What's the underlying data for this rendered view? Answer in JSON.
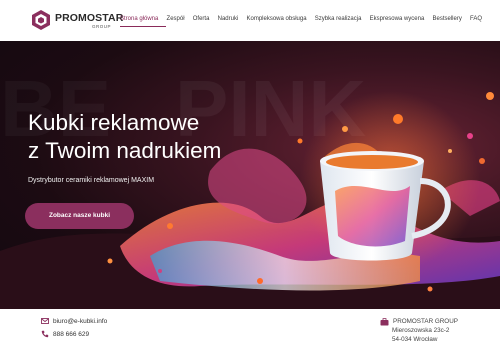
{
  "brand": {
    "name": "PROMOSTAR",
    "sub": "GROUP"
  },
  "nav": {
    "items": [
      {
        "label": "Strona główna",
        "active": true
      },
      {
        "label": "Zespół"
      },
      {
        "label": "Oferta"
      },
      {
        "label": "Nadruki"
      },
      {
        "label": "Kompleksowa obsługa"
      },
      {
        "label": "Szybka realizacja"
      },
      {
        "label": "Ekspresowa wycena"
      },
      {
        "label": "Bestsellery"
      },
      {
        "label": "FAQ"
      }
    ]
  },
  "hero": {
    "title_line1": "Kubki reklamowe",
    "title_line2": "z Twoim nadrukiem",
    "subtitle": "Dystrybutor ceramiki reklamowej MAXIM",
    "cta_label": "Zobacz nasze kubki"
  },
  "contact": {
    "email": "biuro@e-kubki.info",
    "phone": "888 666 629"
  },
  "company": {
    "name": "PROMOSTAR GROUP",
    "street": "Mieroszowska 23c-2",
    "city": "54-034 Wrocław"
  },
  "colors": {
    "accent": "#8b2f5e",
    "hero_dark": "#1c0b12"
  }
}
